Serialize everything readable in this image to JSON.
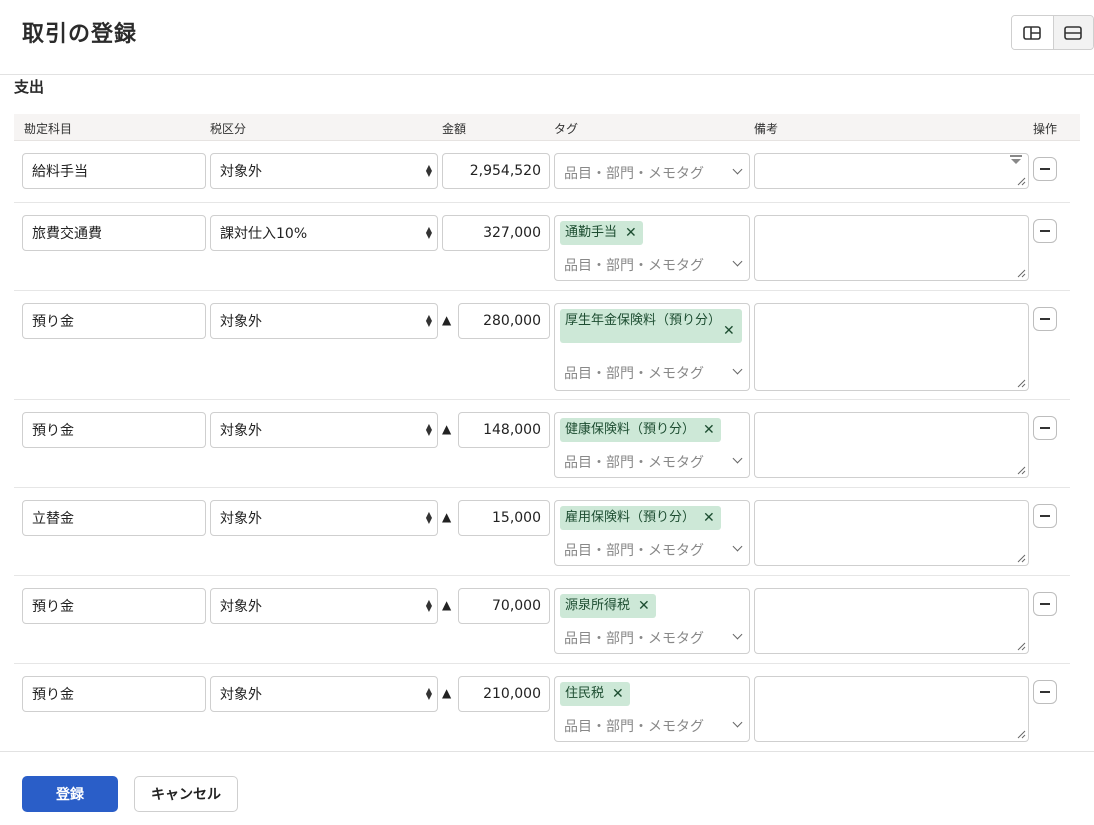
{
  "dialog": {
    "title": "取引の登録"
  },
  "section": {
    "title": "支出"
  },
  "columns": {
    "account": "勘定科目",
    "tax": "税区分",
    "amount": "金額",
    "tag": "タグ",
    "memo": "備考",
    "action": "操作"
  },
  "tag_placeholder": "品目・部門・メモタグ",
  "negative_marker": "▲",
  "rows": [
    {
      "account": "給料手当",
      "tax": "対象外",
      "amount": "2,954,520",
      "negative": false,
      "tag": ""
    },
    {
      "account": "旅費交通費",
      "tax": "課対仕入10%",
      "amount": "327,000",
      "negative": false,
      "tag": "通勤手当"
    },
    {
      "account": "預り金",
      "tax": "対象外",
      "amount": "280,000",
      "negative": true,
      "tag": "厚生年金保険料（預り分）"
    },
    {
      "account": "預り金",
      "tax": "対象外",
      "amount": "148,000",
      "negative": true,
      "tag": "健康保険料（預り分）"
    },
    {
      "account": "立替金",
      "tax": "対象外",
      "amount": "15,000",
      "negative": true,
      "tag": "雇用保険料（預り分）"
    },
    {
      "account": "預り金",
      "tax": "対象外",
      "amount": "70,000",
      "negative": true,
      "tag": "源泉所得税"
    },
    {
      "account": "預り金",
      "tax": "対象外",
      "amount": "210,000",
      "negative": true,
      "tag": "住民税"
    }
  ],
  "footer": {
    "submit_label": "登録",
    "cancel_label": "キャンセル"
  },
  "colors": {
    "primary": "#2a5ec8",
    "tag_bg": "#cde8d7",
    "tag_text": "#1d4d31",
    "header_bg": "#f6f4f3"
  }
}
